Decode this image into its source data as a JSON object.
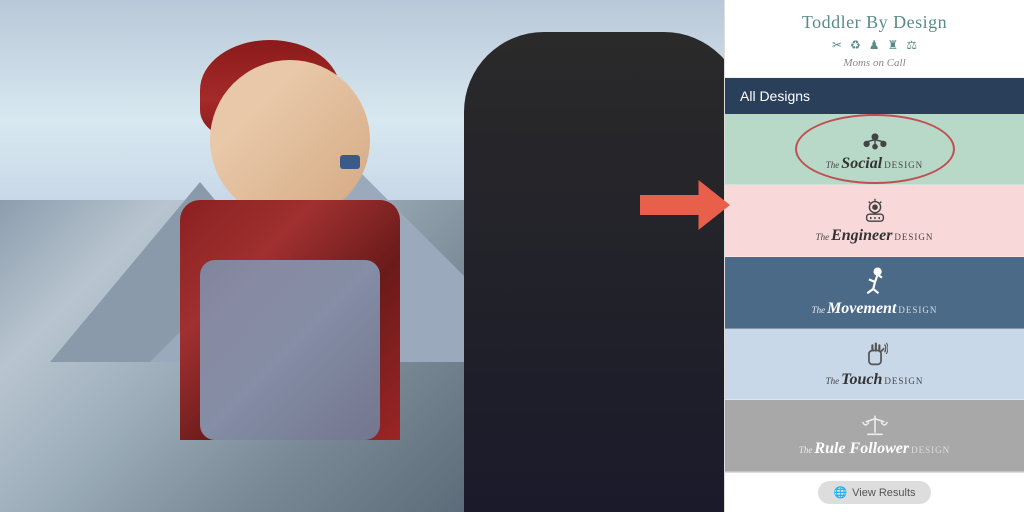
{
  "app": {
    "title": "Toddler By Design",
    "subtitle": "Moms on Call",
    "icons": [
      "✂",
      "♻",
      "♟",
      "♜",
      "⚖"
    ]
  },
  "header": {
    "all_designs_label": "All Designs"
  },
  "designs": [
    {
      "id": "social",
      "the_label": "The",
      "name": "Social",
      "design_suffix": "Design",
      "bg": "#b8d8c8",
      "highlighted": true,
      "icon_type": "network"
    },
    {
      "id": "engineer",
      "the_label": "The",
      "name": "Engineer",
      "design_suffix": "Design",
      "bg": "#f8d8d8",
      "highlighted": false,
      "icon_type": "gear"
    },
    {
      "id": "movement",
      "the_label": "The",
      "name": "Movement",
      "design_suffix": "Design",
      "bg": "#4a6a88",
      "highlighted": false,
      "dark": true,
      "icon_type": "person-running"
    },
    {
      "id": "touch",
      "the_label": "The",
      "name": "Touch",
      "design_suffix": "Design",
      "bg": "#c8d8e8",
      "highlighted": false,
      "icon_type": "hand"
    },
    {
      "id": "rule-follower",
      "the_label": "The",
      "name": "Rule Follower",
      "design_suffix": "Design",
      "bg": "#a8a8a8",
      "highlighted": false,
      "dark": true,
      "icon_type": "scale"
    }
  ],
  "view_results": {
    "label": "View Results",
    "icon": "🌐"
  },
  "arrow": {
    "color": "#e8604a"
  }
}
